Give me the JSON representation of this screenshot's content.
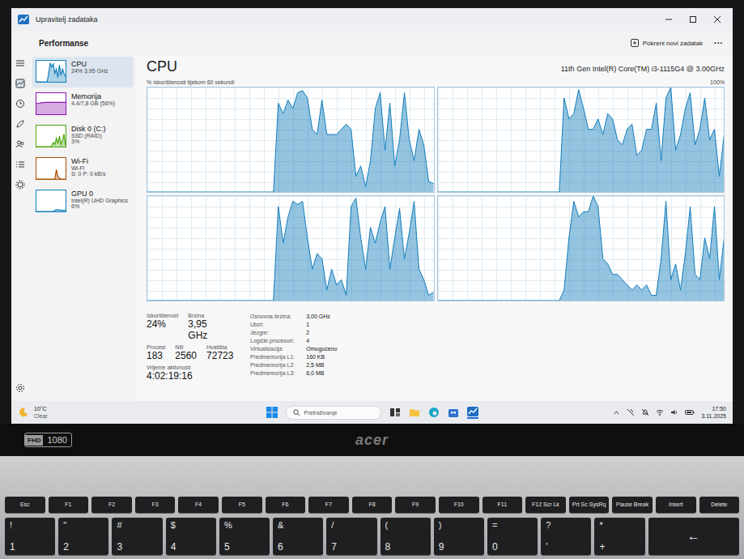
{
  "window": {
    "title": "Upravitelj zadataka",
    "page": "Performanse",
    "new_task": "Pokreni novi zadatak",
    "more": "···"
  },
  "sidebar": {
    "items": [
      {
        "name": "CPU",
        "lines": [
          "24% 3,95 GHz"
        ],
        "selected": true,
        "color": "#117dbb",
        "spark": [
          0,
          0,
          0,
          0,
          0,
          0,
          0,
          0,
          40,
          90,
          70,
          85,
          40,
          60,
          20,
          80,
          30,
          60,
          40,
          25
        ]
      },
      {
        "name": "Memorija",
        "lines": [
          "4,4/7,8 GB (56%)"
        ],
        "selected": false,
        "color": "#8b12ae",
        "spark": [
          50,
          52,
          53,
          54,
          55,
          55,
          56,
          56,
          56,
          56,
          56,
          56,
          56,
          56,
          56,
          56,
          56,
          56,
          56,
          56
        ]
      },
      {
        "name": "Disk 0 (C:)",
        "lines": [
          "SSD (RAID)",
          "3%"
        ],
        "selected": false,
        "color": "#4da60c",
        "spark": [
          0,
          0,
          0,
          0,
          0,
          0,
          0,
          0,
          0,
          0,
          5,
          20,
          10,
          40,
          15,
          50,
          10,
          30,
          60,
          5
        ]
      },
      {
        "name": "Wi-Fi",
        "lines": [
          "Wi-Fi",
          "S: 0 P: 0 kB/s"
        ],
        "selected": false,
        "color": "#a74f01",
        "spark": [
          0,
          0,
          0,
          0,
          0,
          0,
          0,
          0,
          0,
          0,
          0,
          0,
          0,
          45,
          10,
          5,
          0,
          0,
          0,
          0
        ]
      },
      {
        "name": "GPU 0",
        "lines": [
          "Intel(R) UHD Graphics",
          "6%"
        ],
        "selected": false,
        "color": "#117dbb",
        "spark": [
          0,
          0,
          0,
          0,
          0,
          0,
          0,
          0,
          0,
          0,
          0,
          0,
          5,
          10,
          6,
          8,
          5,
          6,
          4,
          6
        ]
      }
    ]
  },
  "cpu": {
    "title": "CPU",
    "model": "11th Gen Intel(R) Core(TM) i3-1115G4 @ 3.00GHz",
    "chart_label": "% iskorištenosti tijekom 60 sekundi",
    "chart_max": "100%",
    "cores": [
      [
        0,
        0,
        0,
        0,
        0,
        0,
        0,
        0,
        0,
        0,
        0,
        0,
        0,
        0,
        0,
        0,
        0,
        0,
        0,
        0,
        0,
        0,
        0,
        0,
        0,
        0,
        0,
        85,
        75,
        88,
        80,
        95,
        97,
        90,
        60,
        55,
        88,
        55,
        55,
        55,
        60,
        65,
        60,
        15,
        25,
        5,
        30,
        80,
        95,
        40,
        85,
        25,
        50,
        95,
        50,
        30,
        60,
        45,
        10,
        8
      ],
      [
        0,
        0,
        0,
        0,
        0,
        0,
        0,
        0,
        0,
        0,
        0,
        0,
        0,
        0,
        0,
        0,
        0,
        0,
        0,
        0,
        0,
        0,
        0,
        0,
        0,
        0,
        90,
        70,
        75,
        98,
        80,
        60,
        60,
        70,
        55,
        75,
        70,
        50,
        45,
        60,
        65,
        35,
        40,
        60,
        60,
        85,
        30,
        90,
        100,
        40,
        55,
        80,
        95,
        45,
        60,
        90,
        50,
        60,
        15,
        55
      ],
      [
        0,
        0,
        0,
        0,
        0,
        0,
        0,
        0,
        0,
        0,
        0,
        0,
        0,
        0,
        0,
        0,
        0,
        0,
        0,
        0,
        0,
        0,
        0,
        0,
        0,
        0,
        0,
        90,
        55,
        80,
        95,
        92,
        95,
        60,
        30,
        45,
        40,
        10,
        30,
        15,
        20,
        5,
        90,
        98,
        60,
        30,
        70,
        55,
        75,
        90,
        30,
        60,
        88,
        40,
        65,
        95,
        30,
        20,
        5,
        8
      ],
      [
        0,
        0,
        0,
        0,
        0,
        0,
        0,
        0,
        0,
        0,
        0,
        0,
        0,
        0,
        0,
        0,
        0,
        0,
        0,
        0,
        0,
        0,
        0,
        0,
        0,
        0,
        10,
        60,
        95,
        80,
        85,
        85,
        100,
        90,
        40,
        35,
        25,
        25,
        20,
        15,
        10,
        15,
        10,
        15,
        5,
        5,
        40,
        95,
        20,
        35,
        10,
        45,
        90,
        25,
        20,
        60,
        40,
        90,
        20,
        60
      ]
    ],
    "stats": [
      {
        "label": "Iskorištenost",
        "value": "24%"
      },
      {
        "label": "Brzina",
        "value": "3,95 GHz"
      }
    ],
    "counts": [
      {
        "label": "Procesi",
        "value": "183"
      },
      {
        "label": "Niti",
        "value": "2560"
      },
      {
        "label": "Hvatišta",
        "value": "72723"
      }
    ],
    "uptime": {
      "label": "Vrijeme aktivnosti",
      "value": "4:02:19:16"
    },
    "specs": [
      {
        "label": "Osnovna brzina:",
        "value": "3,00 GHz"
      },
      {
        "label": "Utori:",
        "value": "1"
      },
      {
        "label": "Jezgre:",
        "value": "2"
      },
      {
        "label": "Logički procesori:",
        "value": "4"
      },
      {
        "label": "Virtualizacija:",
        "value": "Omogućeno"
      },
      {
        "label": "Predmemorija L1:",
        "value": "160 KB"
      },
      {
        "label": "Predmemorija L2:",
        "value": "2,5 MB"
      },
      {
        "label": "Predmemorija L3:",
        "value": "6,0 MB"
      }
    ]
  },
  "taskbar": {
    "weather": {
      "temp": "10°C",
      "condition": "Clear"
    },
    "search": {
      "placeholder": "Pretraživanje"
    },
    "time": "17:50",
    "date": "3.11.2025"
  },
  "laptop": {
    "badge_left": "FHD",
    "badge_right": "1080",
    "logo": "acer"
  },
  "keyboard": {
    "function_row": [
      "Esc",
      "F1",
      "F2",
      "F3",
      "F4",
      "F5",
      "F6",
      "F7",
      "F8",
      "F9",
      "F10",
      "F11",
      "F12 Scr Lk",
      "Prt Sc SysRq",
      "Pause Break",
      "Insert",
      "Delete"
    ],
    "number_row": [
      {
        "top": "!",
        "bottom": "1"
      },
      {
        "top": "\"",
        "bottom": "2"
      },
      {
        "top": "#",
        "bottom": "3"
      },
      {
        "top": "$",
        "bottom": "4"
      },
      {
        "top": "%",
        "bottom": "5"
      },
      {
        "top": "&",
        "bottom": "6"
      },
      {
        "top": "/",
        "bottom": "7"
      },
      {
        "top": "(",
        "bottom": "8"
      },
      {
        "top": ")",
        "bottom": "9"
      },
      {
        "top": "=",
        "bottom": "0"
      },
      {
        "top": "?",
        "bottom": "'"
      },
      {
        "top": "*",
        "bottom": "+"
      }
    ],
    "backspace": "←"
  }
}
